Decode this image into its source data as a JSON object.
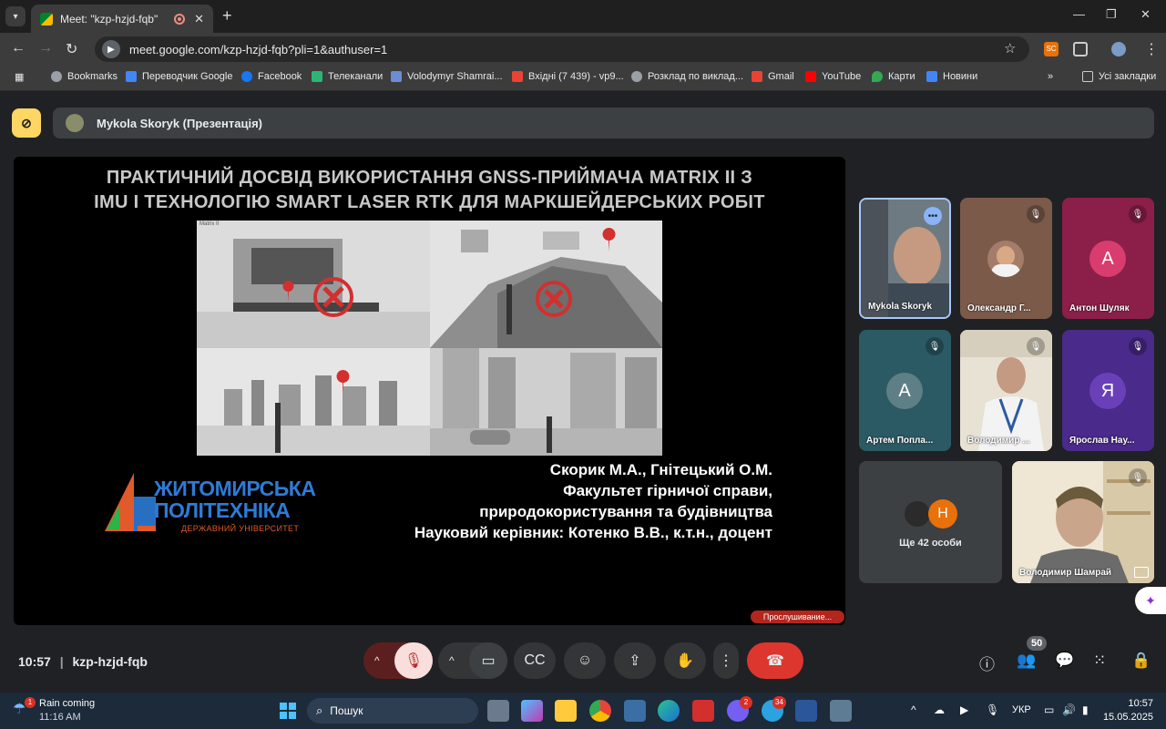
{
  "browser": {
    "tab_title": "Meet: \"kzp-hzjd-fqb\"",
    "url": "meet.google.com/kzp-hzjd-fqb?pli=1&authuser=1",
    "bookmarks": [
      "Bookmarks",
      "Переводчик Google",
      "Facebook",
      "Телеканали",
      "Volodymyr Shamrai...",
      "Вхідні (7 439) - vp9...",
      "Розклад по виклад...",
      "Gmail",
      "YouTube",
      "Карти",
      "Новини"
    ],
    "all_bookmarks": "Усі закладки",
    "ext_badge": "SC"
  },
  "meet": {
    "presenter_label": "Mykola Skoryk (Презентація)",
    "slide": {
      "title_line1": "ПРАКТИЧНИЙ ДОСВІД ВИКОРИСТАННЯ GNSS-ПРИЙМАЧА MATRIX II З",
      "title_line2": "IMU І ТЕХНОЛОГІЮ SMART LASER RTK ДЛЯ МАРКШЕЙДЕРСЬКИХ РОБІТ",
      "video_label": "Matrix II",
      "authors": "Скорик М.А., Гнітецький О.М.",
      "faculty_line1": "Факультет гірничої справи,",
      "faculty_line2": "природокористування та будівництва",
      "supervisor": "Науковий керівник: Котенко В.В., к.т.н., доцент",
      "logo_line1": "ЖИТОМИРСЬКА",
      "logo_line2": "ПОЛІТЕХНІКА",
      "logo_line3": "ДЕРЖАВНИЙ УНІВЕРСИТЕТ"
    },
    "listening_badge": "Прослушивание...",
    "participants": [
      {
        "name": "Mykola Skoryk"
      },
      {
        "name": "Олександр Г..."
      },
      {
        "name": "Антон Шуляк",
        "initial": "А"
      },
      {
        "name": "Артем Попла...",
        "initial": "А"
      },
      {
        "name": "Володимир ..."
      },
      {
        "name": "Ярослав Нау...",
        "initial": "Я"
      },
      {
        "name": "Володимир Шамрай"
      }
    ],
    "others": {
      "label": "Ще 42 особи",
      "initial": "Н"
    },
    "clock": "10:57",
    "meeting_code": "kzp-hzjd-fqb",
    "participants_count": "50"
  },
  "taskbar": {
    "weather_title": "Rain coming",
    "weather_time": "11:16 AM",
    "weather_badge": "1",
    "search_placeholder": "Пошук",
    "viber_badge": "2",
    "telegram_badge": "34",
    "lang": "УКР",
    "time": "10:57",
    "date": "15.05.2025"
  }
}
